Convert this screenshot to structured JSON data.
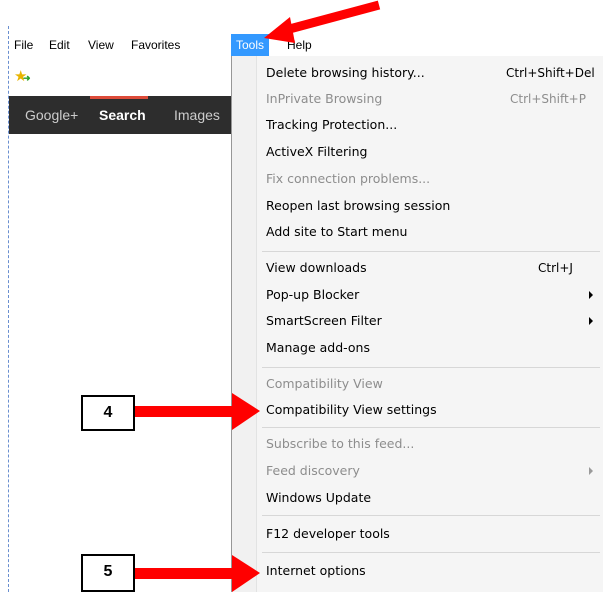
{
  "menubar": {
    "items": [
      {
        "label": "File"
      },
      {
        "label": "Edit"
      },
      {
        "label": "View"
      },
      {
        "label": "Favorites"
      },
      {
        "label": "Tools"
      },
      {
        "label": "Help"
      }
    ]
  },
  "favorites_bar": {
    "icon": "add-favorite-star-icon"
  },
  "google_bar": {
    "items": [
      {
        "label": "Google+"
      },
      {
        "label": "Search"
      },
      {
        "label": "Images"
      }
    ]
  },
  "tools_menu": {
    "items": [
      {
        "label": "Delete browsing history...",
        "shortcut": "Ctrl+Shift+Del",
        "enabled": true
      },
      {
        "label": "InPrivate Browsing",
        "shortcut": "Ctrl+Shift+P",
        "enabled": false
      },
      {
        "label": "Tracking Protection...",
        "enabled": true
      },
      {
        "label": "ActiveX Filtering",
        "enabled": true
      },
      {
        "label": "Fix connection problems...",
        "enabled": false
      },
      {
        "label": "Reopen last browsing session",
        "enabled": true
      },
      {
        "label": "Add site to Start menu",
        "enabled": true
      },
      {
        "label": "View downloads",
        "shortcut": "Ctrl+J",
        "enabled": true
      },
      {
        "label": "Pop-up Blocker",
        "submenu": true,
        "enabled": true
      },
      {
        "label": "SmartScreen Filter",
        "submenu": true,
        "enabled": true
      },
      {
        "label": "Manage add-ons",
        "enabled": true
      },
      {
        "label": "Compatibility View",
        "enabled": false
      },
      {
        "label": "Compatibility View settings",
        "enabled": true
      },
      {
        "label": "Subscribe to this feed...",
        "enabled": false
      },
      {
        "label": "Feed discovery",
        "submenu": true,
        "enabled": false
      },
      {
        "label": "Windows Update",
        "enabled": true
      },
      {
        "label": "F12 developer tools",
        "enabled": true
      },
      {
        "label": "Internet options",
        "enabled": true
      }
    ]
  },
  "annotations": {
    "step4": "4",
    "step5": "5",
    "arrow_color": "#ff0000"
  }
}
